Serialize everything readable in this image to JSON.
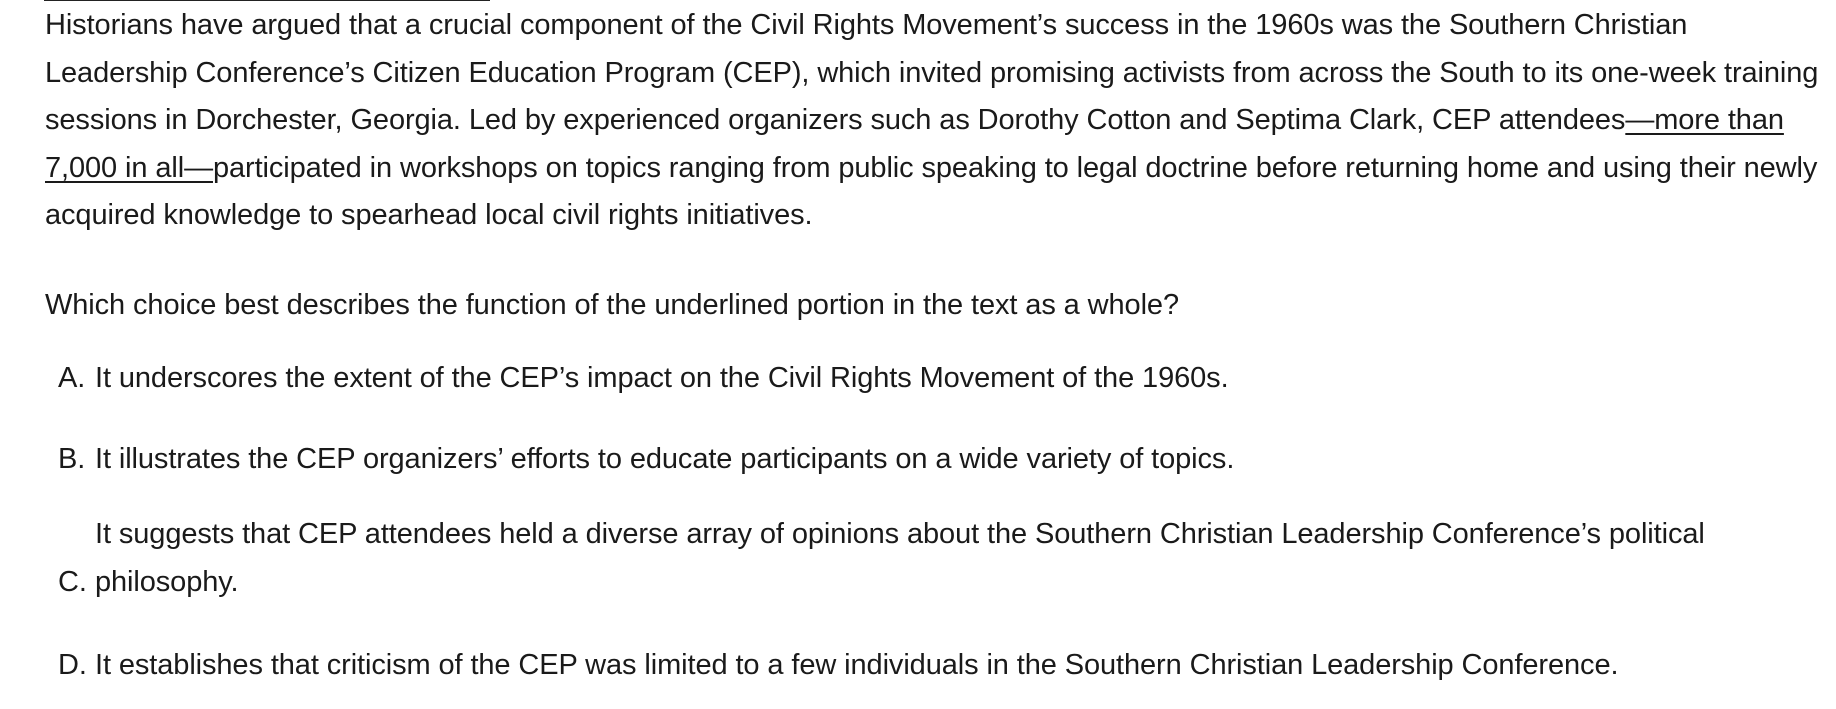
{
  "passage": {
    "before": "Historians have argued that a crucial component of the Civil Rights Movement’s success in the 1960s was the Southern Christian Leadership Conference’s Citizen Education Program (CEP), which invited promising activists from across the South to its one-week training sessions in Dorchester, Georgia. Led by experienced organizers such as Dorothy Cotton and Septima Clark, CEP attendees",
    "underlined": "—more than 7,000 in all—",
    "after": "participated in workshops on topics ranging from public speaking to legal doctrine before returning home and using their newly acquired knowledge to spearhead local civil rights initiatives."
  },
  "question": "Which choice best describes the function of the underlined portion in the text as a whole?",
  "choices": [
    {
      "letter": "A.",
      "text": "It underscores the extent of the CEP’s impact on the Civil Rights Movement of the 1960s."
    },
    {
      "letter": "B.",
      "text": "It illustrates the CEP organizers’ efforts to educate participants on a wide variety of topics."
    },
    {
      "letter": "C.",
      "text": "It suggests that CEP attendees held a diverse array of opinions about the Southern Christian Leadership Conference’s political philosophy."
    },
    {
      "letter": "D.",
      "text": "It establishes that criticism of the CEP was limited to a few individuals in the Southern Christian Leadership Conference."
    }
  ]
}
